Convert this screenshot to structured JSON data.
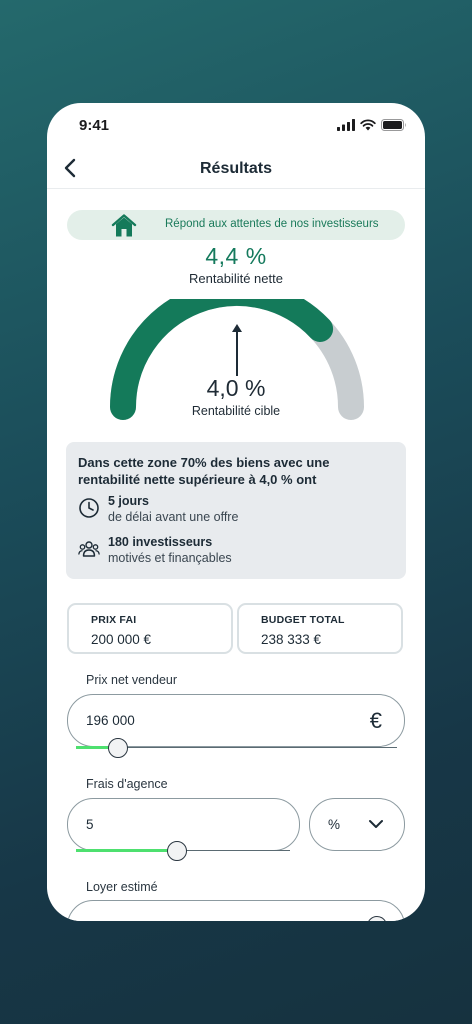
{
  "status_bar": {
    "time": "9:41"
  },
  "nav": {
    "title": "Résultats"
  },
  "banner": {
    "text": "Répond aux attentes de nos investisseurs"
  },
  "gauge": {
    "net_value": "4,4 %",
    "net_label": "Rentabilité nette",
    "target_value": "4,0 %",
    "target_label": "Rentabilité cible",
    "fill_fraction": 0.76,
    "target_fraction": 0.5,
    "colors": {
      "fill": "#147a5a",
      "track": "#c8cdd0",
      "arrow": "#1d2b36"
    }
  },
  "info": {
    "heading": "Dans cette zone 70% des biens avec une rentabilité nette supérieure à 4,0 % ont",
    "rows": [
      {
        "icon": "clock-icon",
        "title": "5 jours",
        "subtitle": "de délai avant une offre"
      },
      {
        "icon": "people-group-icon",
        "title": "180 investisseurs",
        "subtitle": "motivés et finançables"
      }
    ]
  },
  "summary": {
    "prix_label": "PRIX FAI",
    "prix_value": "200 000 €",
    "budget_label": "BUDGET TOTAL",
    "budget_value": "238 333 €"
  },
  "fields": {
    "prix_net": {
      "label": "Prix net vendeur",
      "value": "196 000",
      "unit": "€",
      "slider_fraction": 0.13
    },
    "frais": {
      "label": "Frais d'agence",
      "value": "5",
      "unit": "%",
      "slider_fraction": 0.47
    },
    "loyer": {
      "label": "Loyer estimé"
    }
  },
  "colors": {
    "accent": "#147a5a",
    "slider_fill": "#4ee06f",
    "banner_bg": "#e3efe9"
  }
}
